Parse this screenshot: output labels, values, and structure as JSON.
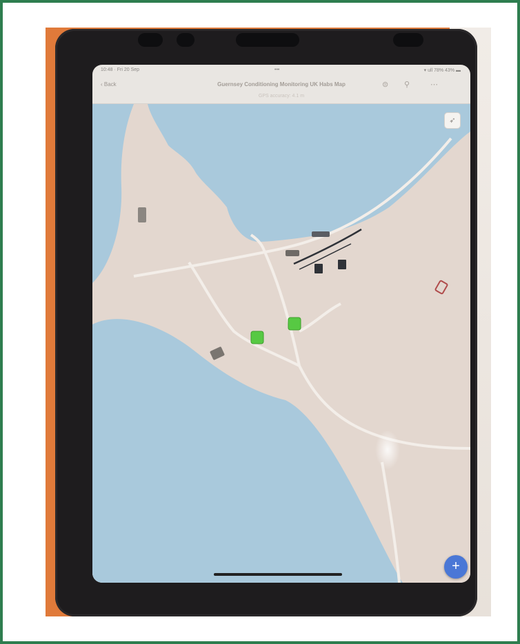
{
  "status_bar": {
    "time": "10:48 · Fri 20 Sep",
    "center": "•••",
    "right": "▾ ull 78% 43% ▬"
  },
  "nav": {
    "back_label": "‹ Back",
    "title": "Guernsey Conditioning Monitoring UK Habs Map",
    "icons": [
      "layers-icon",
      "search-icon",
      "more-icon"
    ]
  },
  "gps_text": "GPS accuracy: 4.1 m",
  "colors": {
    "water": "#a9c9dc",
    "land": "#e3d7cf",
    "road": "#f3eee9",
    "green_marker": "#57c943",
    "dark_marker": "#3b3e45",
    "gray_marker": "#8b8681",
    "red_marker": "#b04b4b",
    "fab": "#4a77d6"
  },
  "fab_label": "+",
  "compass_glyph": "➶"
}
